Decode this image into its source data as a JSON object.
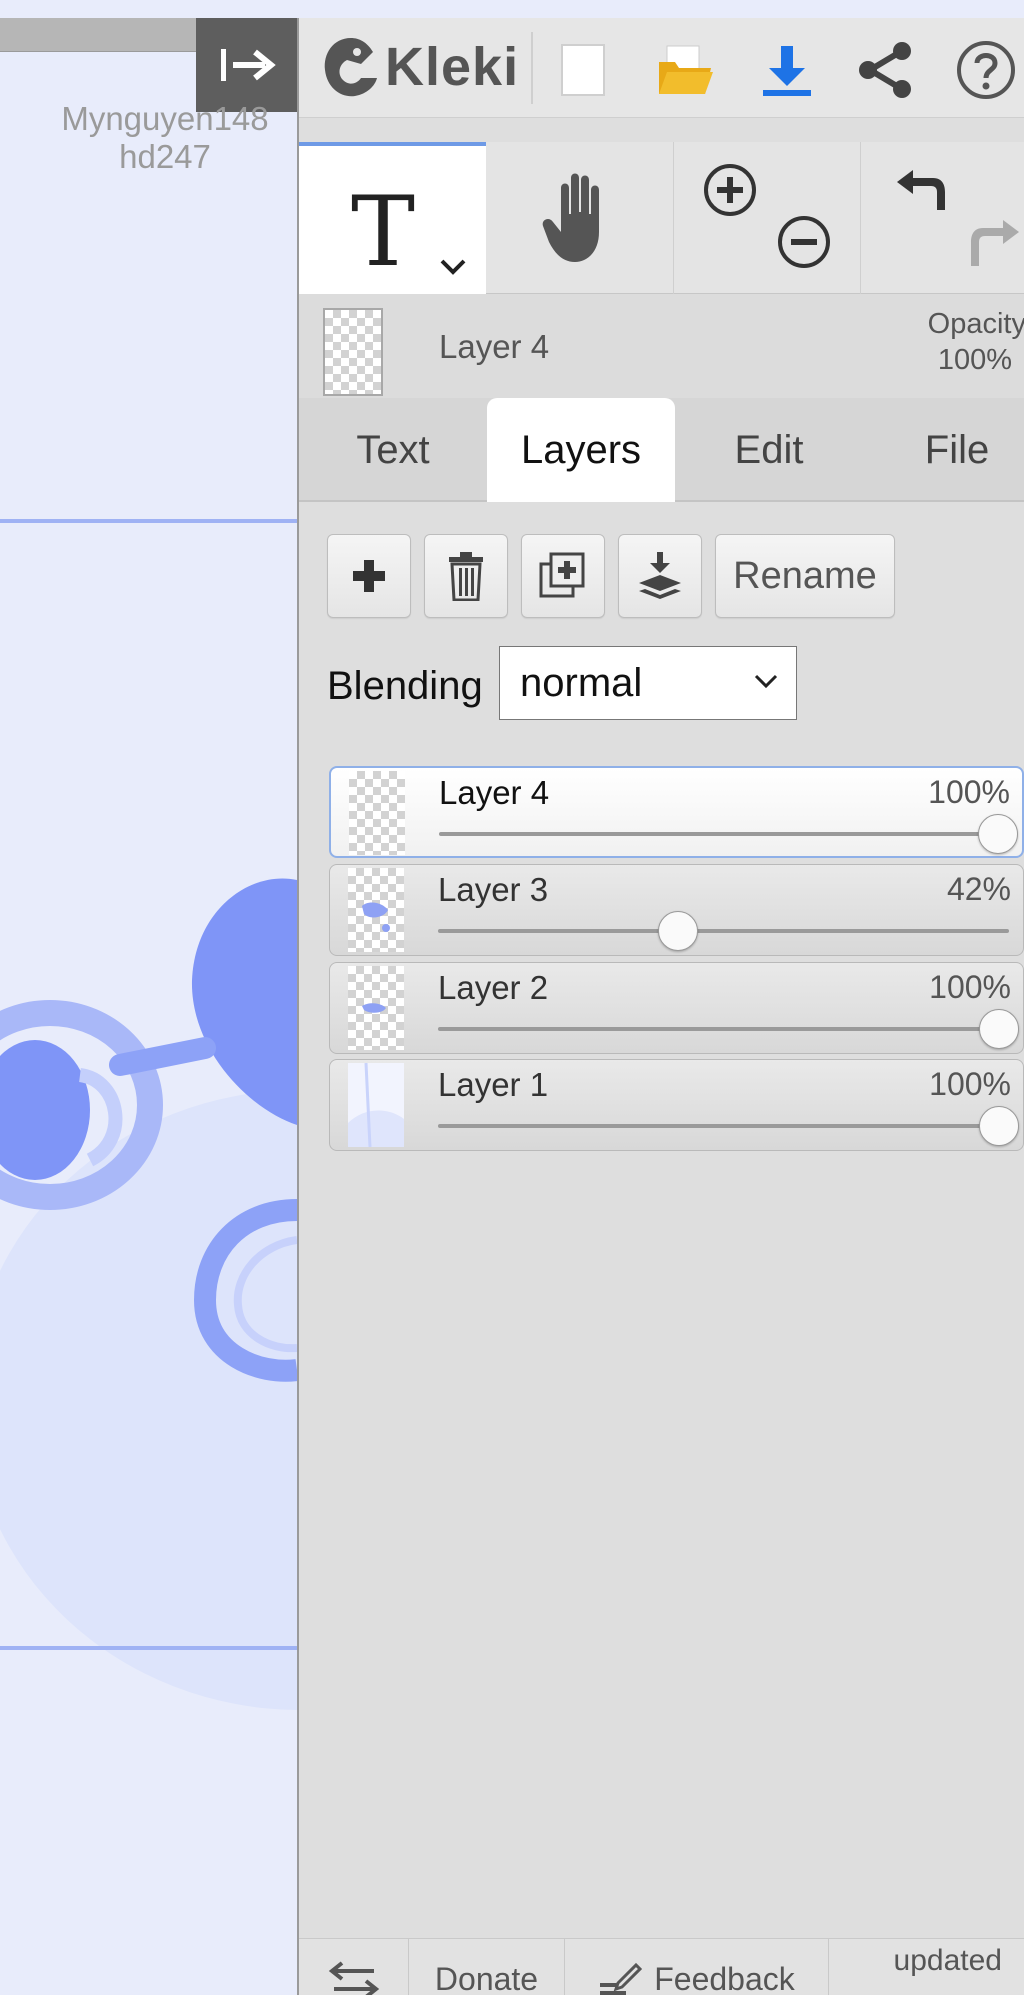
{
  "app": {
    "title": "Kleki"
  },
  "canvas": {
    "credit_line1": "Mynguyen148",
    "credit_line2": "hd247",
    "accent_color": "#7f95f7"
  },
  "header": {
    "logo_text": "Kleki",
    "icons": [
      "new-image-icon",
      "open-folder-icon",
      "download-icon",
      "share-icon",
      "help-icon"
    ]
  },
  "toolbar": {
    "text_tool_glyph": "T",
    "tools": [
      "text-tool",
      "hand-tool",
      "zoom-in-out",
      "undo-redo"
    ]
  },
  "active_layer": {
    "name": "Layer 4",
    "opacity_label": "Opacity",
    "opacity_value": "100%"
  },
  "tabs": [
    {
      "label": "Text",
      "active": false
    },
    {
      "label": "Layers",
      "active": true
    },
    {
      "label": "Edit",
      "active": false
    },
    {
      "label": "File",
      "active": false
    }
  ],
  "layer_actions": {
    "rename_label": "Rename",
    "icons": [
      "add-layer-icon",
      "delete-layer-icon",
      "duplicate-layer-icon",
      "merge-down-icon"
    ]
  },
  "blending": {
    "label": "Blending",
    "value": "normal"
  },
  "layers": [
    {
      "name": "Layer 4",
      "opacity_text": "100%",
      "opacity": 1.0,
      "selected": true
    },
    {
      "name": "Layer 3",
      "opacity_text": "42%",
      "opacity": 0.42,
      "selected": false
    },
    {
      "name": "Layer 2",
      "opacity_text": "100%",
      "opacity": 1.0,
      "selected": false
    },
    {
      "name": "Layer 1",
      "opacity_text": "100%",
      "opacity": 1.0,
      "selected": false
    }
  ],
  "footer": {
    "donate_label": "Donate",
    "feedback_label": "Feedback",
    "updated_label": "updated"
  }
}
